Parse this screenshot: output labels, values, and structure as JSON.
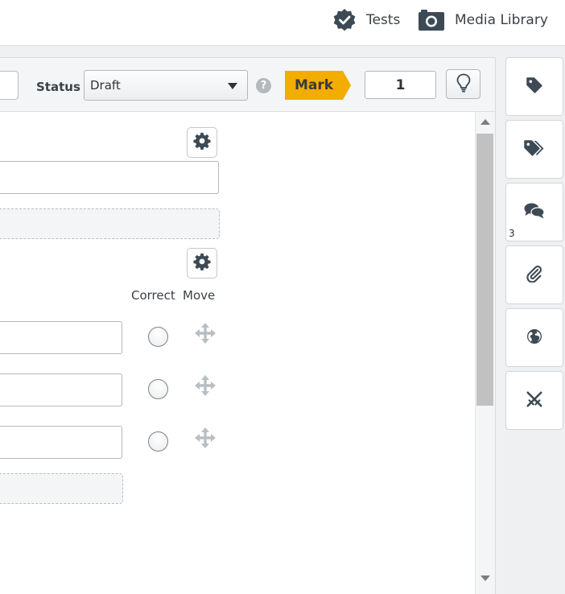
{
  "header": {
    "nav": [
      {
        "label": "Tests",
        "icon": "badge-check-icon"
      },
      {
        "label": "Media Library",
        "icon": "camera-icon"
      }
    ]
  },
  "toolbar": {
    "status_label": "Status",
    "status_colon": " :",
    "status_value": "Draft",
    "help_text": "?",
    "mark_label": "Mark",
    "marks_value": "1",
    "mark_color": "#f3ac00"
  },
  "answers": {
    "columns": {
      "correct": "Correct",
      "move": "Move"
    },
    "count": 3
  },
  "sidebar": {
    "items": [
      {
        "icon": "tag-icon"
      },
      {
        "icon": "tags-icon"
      },
      {
        "icon": "comments-icon",
        "badge": "3"
      },
      {
        "icon": "paperclip-icon"
      },
      {
        "icon": "globe-icon"
      },
      {
        "icon": "crossed-swords-icon"
      }
    ]
  },
  "colors": {
    "icon_dark": "#3d4a55",
    "move_handle": "#b9bec4"
  }
}
